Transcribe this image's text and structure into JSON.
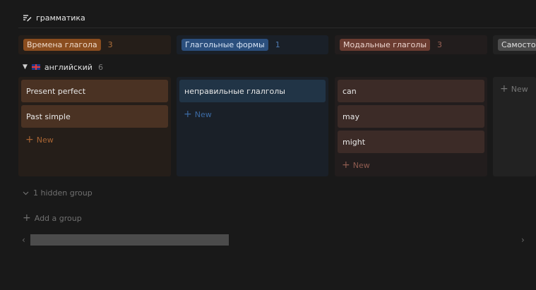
{
  "view": {
    "title": "грамматика",
    "icon": "edit-list-icon"
  },
  "columns": [
    {
      "label": "Времена глагола",
      "count": "3",
      "color": "#8a4d1f"
    },
    {
      "label": "Глагольные формы",
      "count": "1",
      "color": "#2b4f7d"
    },
    {
      "label": "Модальные глаголы",
      "count": "3",
      "color": "#6b3c31"
    },
    {
      "label": "Самостоятельные",
      "count": "",
      "color": "#4c4c4c"
    }
  ],
  "group": {
    "name": "английский",
    "count": "6",
    "flag_icon": "uk-flag-icon"
  },
  "cards": {
    "col1": [
      "Present perfect",
      "Past simple"
    ],
    "col2": [
      "неправильные глалголы"
    ],
    "col3": [
      "can",
      "may",
      "might"
    ]
  },
  "new_label": "New",
  "hidden_group_label": "1 hidden group",
  "add_group_label": "Add a group"
}
